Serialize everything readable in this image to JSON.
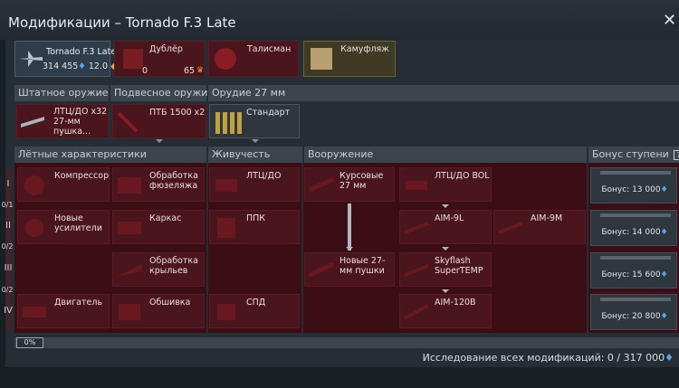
{
  "title": "Модификации – Tornado F.3 Late",
  "unit": {
    "name": "Tornado F.3 Late",
    "stat_line": "314 455",
    "br": "12.0"
  },
  "top_slots": [
    {
      "label": "Дублёр",
      "count_left": "0",
      "count_right": "65"
    },
    {
      "label": "Талисман"
    },
    {
      "label": "Камуфляж"
    }
  ],
  "weapon_headers": [
    "Штатное оружие",
    "Подвесное оружие",
    "Орудие 27 мм"
  ],
  "weapon_slots": [
    {
      "label": "ЛТЦ/ДО x32 27-мм пушка..."
    },
    {
      "label": "ПТБ 1500 x2"
    },
    {
      "label": "Стандарт"
    }
  ],
  "section_headers": [
    "Лётные характеристики",
    "Живучесть",
    "Вооружение",
    "Бонус ступени"
  ],
  "help_icon": "?",
  "tiers": [
    {
      "roman": "I",
      "frac": "0/1"
    },
    {
      "roman": "II",
      "frac": "0/2"
    },
    {
      "roman": "III",
      "frac": "0/2"
    },
    {
      "roman": "IV",
      "frac": ""
    }
  ],
  "mods": {
    "compressor": "Компрессор",
    "fuselage": "Обработка фюзеляжа",
    "ltc1": "ЛТЦ/ДО",
    "cannon27": "Курсовые 27 мм",
    "ltc_bol": "ЛТЦ/ДО BOL",
    "boosters": "Новые усилители",
    "frame": "Каркас",
    "ppk": "ППК",
    "aim9l": "AIM-9L",
    "aim9m": "AIM-9M",
    "wings": "Обработка крыльев",
    "new27": "Новые 27-мм пушки",
    "skyflash": "Skyflash SuperTEMP",
    "engine": "Двигатель",
    "skin": "Обшивка",
    "spd": "СПД",
    "aim120": "AIM-120B"
  },
  "bonuses": [
    "Бонус: 13 000",
    "Бонус: 14 000",
    "Бонус: 15 600",
    "Бонус: 20 800"
  ],
  "progress": {
    "percent_label": "0%",
    "fraction": 0
  },
  "footer": "Исследование всех модификаций: 0 / 317 000",
  "colors": {
    "mod_bg": "#4a151c",
    "grid_bg": "#3a0e14",
    "panel": "#262e35",
    "rp_icon": "#5aa8e8"
  }
}
